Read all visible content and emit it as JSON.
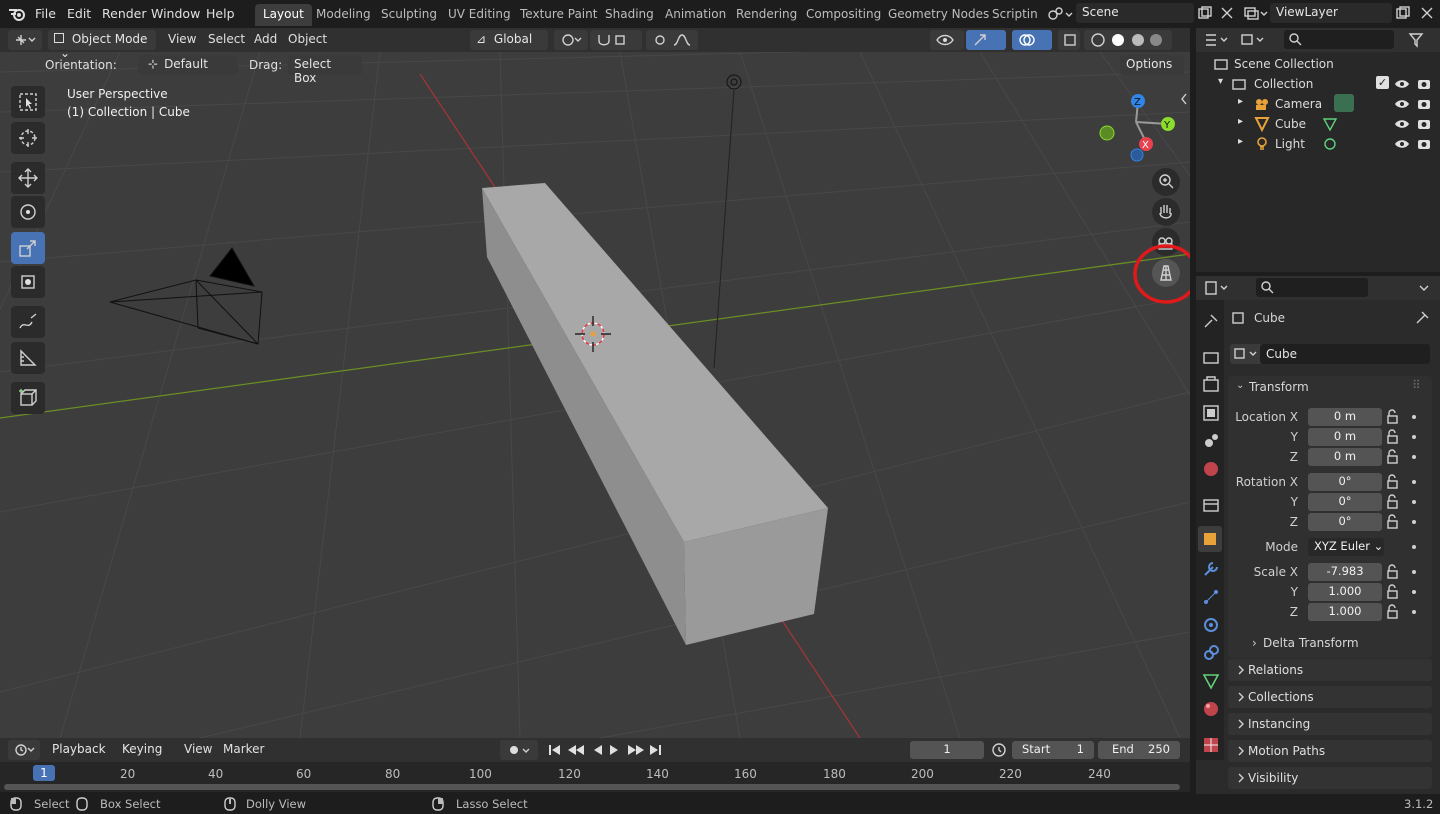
{
  "menu": {
    "file": "File",
    "edit": "Edit",
    "render": "Render",
    "window": "Window",
    "help": "Help"
  },
  "workspaces": [
    "Layout",
    "Modeling",
    "Sculpting",
    "UV Editing",
    "Texture Paint",
    "Shading",
    "Animation",
    "Rendering",
    "Compositing",
    "Geometry Nodes",
    "Scripting"
  ],
  "scene": {
    "name": "Scene",
    "view_layer": "ViewLayer"
  },
  "vp_header": {
    "mode": "Object Mode",
    "view": "View",
    "select": "Select",
    "add": "Add",
    "object": "Object",
    "transform_orientation": "Global"
  },
  "vp_sub": {
    "orientation_label": "Orientation:",
    "orientation_value": "Default",
    "drag_label": "Drag:",
    "drag_value": "Select Box",
    "options": "Options"
  },
  "viewport": {
    "perspective": "User Perspective",
    "context": "(1) Collection | Cube"
  },
  "gizmo": {
    "x": "X",
    "y": "Y",
    "z": "Z"
  },
  "outliner": {
    "scene_collection": "Scene Collection",
    "collection": "Collection",
    "items": [
      "Camera",
      "Cube",
      "Light"
    ]
  },
  "properties": {
    "object_name": "Cube",
    "data_name": "Cube",
    "transform": "Transform",
    "location_label": "Location X",
    "rotation_label": "Rotation X",
    "mode_label": "Mode",
    "scale_label": "Scale X",
    "y": "Y",
    "z": "Z",
    "location": [
      "0 m",
      "0 m",
      "0 m"
    ],
    "rotation": [
      "0°",
      "0°",
      "0°"
    ],
    "rotation_mode": "XYZ Euler",
    "scale": [
      "-7.983",
      "1.000",
      "1.000"
    ],
    "delta_transform": "Delta Transform",
    "panels": [
      "Relations",
      "Collections",
      "Instancing",
      "Motion Paths",
      "Visibility"
    ]
  },
  "timeline": {
    "playback": "Playback",
    "keying": "Keying",
    "view": "View",
    "marker": "Marker",
    "current_frame": "1",
    "start_label": "Start",
    "start": "1",
    "end_label": "End",
    "end": "250",
    "ruler": [
      "1",
      "20",
      "40",
      "60",
      "80",
      "100",
      "120",
      "140",
      "160",
      "180",
      "200",
      "220",
      "240"
    ]
  },
  "status": {
    "select": "Select",
    "box_select": "Box Select",
    "dolly_view": "Dolly View",
    "lasso_select": "Lasso Select",
    "version": "3.1.2"
  },
  "colors": {
    "accent": "#4772b3",
    "highlight_ring": "#e0191b",
    "x_axis": "#e8424f",
    "y_axis": "#8bdc2b",
    "z_axis": "#2f86e8"
  }
}
